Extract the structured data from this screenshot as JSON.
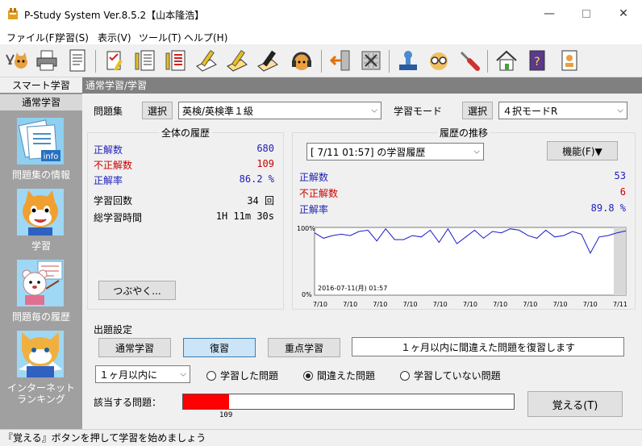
{
  "window": {
    "title": "P-Study System Ver.8.5.2【山本隆浩】"
  },
  "menu": [
    "ファイル(F)",
    "学習(S)",
    "表示(V)",
    "ツール(T)",
    "ヘルプ(H)"
  ],
  "sidebar": {
    "header": "スマート学習",
    "tab": "通常学習",
    "items": [
      "問題集の情報",
      "学習",
      "問題毎の履歴",
      "インターネット",
      "ランキング"
    ]
  },
  "panel": {
    "title": "通常学習/学習"
  },
  "question_set": {
    "label": "問題集",
    "select_label": "選択",
    "value": "英検/英検準１級"
  },
  "study_mode": {
    "label": "学習モード",
    "select_label": "選択",
    "value": "４択モードR"
  },
  "overall": {
    "title": "全体の履歴",
    "correct_label": "正解数",
    "correct_value": "680",
    "incorrect_label": "不正解数",
    "incorrect_value": "109",
    "rate_label": "正解率",
    "rate_value": "86.2 %",
    "count_label": "学習回数",
    "count_value": "34 回",
    "time_label": "総学習時間",
    "time_value": "1H 11m 30s",
    "tweet_button": "つぶやく..."
  },
  "trend": {
    "title": "履歴の推移",
    "session": "[ 7/11 01:57] の学習履歴",
    "func_button": "機能(F)▼",
    "correct_label": "正解数",
    "correct_value": "53",
    "incorrect_label": "不正解数",
    "incorrect_value": "6",
    "rate_label": "正解率",
    "rate_value": "89.8 %"
  },
  "chart_data": {
    "type": "line",
    "ylim": [
      0,
      100
    ],
    "y_ticks": [
      "100%",
      "0%"
    ],
    "x_ticks": [
      "7/10",
      "7/10",
      "7/10",
      "7/10",
      "7/10",
      "7/10",
      "7/10",
      "7/10",
      "7/10",
      "7/10",
      "7/11"
    ],
    "annotation": "2016-07-11(月)  01:57",
    "series": [
      {
        "values": [
          92,
          84,
          88,
          90,
          88,
          94,
          96,
          80,
          98,
          82,
          82,
          88,
          86,
          96,
          78,
          98,
          76,
          86,
          96,
          84,
          94,
          92,
          98,
          96,
          88,
          84,
          96,
          86,
          88,
          94,
          90,
          62,
          86,
          88,
          92,
          95
        ]
      }
    ],
    "line_color": "#1a1ac8"
  },
  "settings": {
    "title": "出題設定",
    "mode_normal": "通常学習",
    "mode_review": "復習",
    "mode_focus": "重点学習",
    "description": "１ヶ月以内に間違えた問題を復習します",
    "period": "１ヶ月以内に",
    "radio_studied": "学習した問題",
    "radio_wrong": "間違えた問題",
    "radio_unstudied": "学習していない問題",
    "matching_label": "該当する問題：",
    "matching_count": "109",
    "matching_fraction": 0.14,
    "memorize_button": "覚える(T)"
  },
  "status": {
    "message": "『覚える』ボタンを押して学習を始めましょう"
  }
}
